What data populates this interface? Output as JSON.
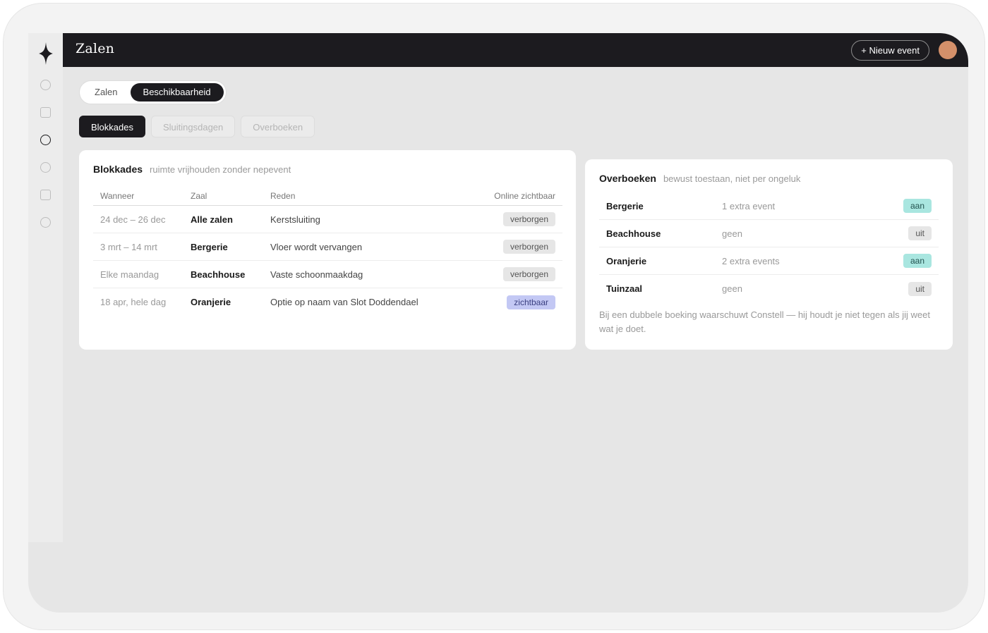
{
  "header": {
    "title": "Zalen",
    "new_event_label": "+ Nieuw event"
  },
  "sidebar": {
    "items": [
      {
        "icon": "circle-icon"
      },
      {
        "icon": "square-icon"
      },
      {
        "icon": "circle-icon",
        "active": true
      },
      {
        "icon": "circle-icon"
      },
      {
        "icon": "square-icon"
      },
      {
        "icon": "circle-icon"
      }
    ]
  },
  "segment": {
    "items": [
      "Zalen",
      "Beschikbaarheid"
    ],
    "active": "Beschikbaarheid"
  },
  "subtabs": {
    "items": [
      "Blokkades",
      "Sluitingsdagen",
      "Overboeken"
    ],
    "active": "Blokkades"
  },
  "blokkades": {
    "title": "Blokkades",
    "subtitle": "ruimte vrijhouden zonder nepevent",
    "columns": [
      "Wanneer",
      "Zaal",
      "Reden",
      "Online zichtbaar"
    ],
    "rows": [
      {
        "when": "24 dec – 26 dec",
        "hall": "Alle zalen",
        "reason": "Kerstsluiting",
        "visibility": "verborgen",
        "visible": false
      },
      {
        "when": "3 mrt – 14 mrt",
        "hall": "Bergerie",
        "reason": "Vloer wordt vervangen",
        "visibility": "verborgen",
        "visible": false
      },
      {
        "when": "Elke maandag",
        "hall": "Beachhouse",
        "reason": "Vaste schoonmaakdag",
        "visibility": "verborgen",
        "visible": false
      },
      {
        "when": "18 apr, hele dag",
        "hall": "Oranjerie",
        "reason": "Optie op naam van Slot Doddendael",
        "visibility": "zichtbaar",
        "visible": true
      }
    ]
  },
  "overboeken": {
    "title": "Overboeken",
    "subtitle": "bewust toestaan, niet per ongeluk",
    "rows": [
      {
        "hall": "Bergerie",
        "value": "1 extra event",
        "state": "aan",
        "on": true
      },
      {
        "hall": "Beachhouse",
        "value": "geen",
        "state": "uit",
        "on": false
      },
      {
        "hall": "Oranjerie",
        "value": "2 extra events",
        "state": "aan",
        "on": true
      },
      {
        "hall": "Tuinzaal",
        "value": "geen",
        "state": "uit",
        "on": false
      }
    ],
    "note": "Bij een dubbele boeking waarschuwt Constell — hij houdt je niet tegen als jij weet wat je doet."
  },
  "colors": {
    "topbar": "#1c1b1f",
    "avatar": "#d4906a",
    "badge_on": "#a9e6e0",
    "badge_visible": "#c3c8f4"
  }
}
